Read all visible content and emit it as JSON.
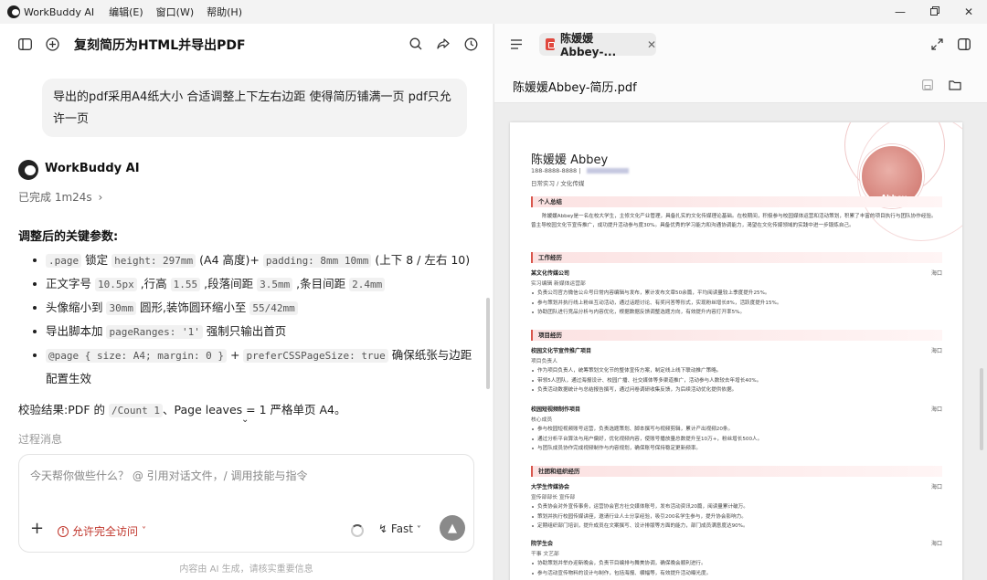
{
  "titlebar": {
    "app_name": "WorkBuddy AI",
    "menus": [
      "编辑(E)",
      "窗口(W)",
      "帮助(H)"
    ]
  },
  "conversation": {
    "title": "复刻简历为HTML并导出PDF",
    "user_message": "导出的pdf采用A4纸大小 合适调整上下左右边距 使得简历铺满一页 pdf只允许一页",
    "ai_name": "WorkBuddy AI",
    "done_status": "已完成 1m24s",
    "section_title": "调整后的关键参数:",
    "bullets": [
      {
        "parts": [
          ".page",
          " 锁定 ",
          "height: 297mm",
          " (A4 高度)+ ",
          "padding: 8mm 10mm",
          " (上下 8 / 左右 10)"
        ]
      },
      {
        "parts": [
          "正文字号 ",
          "10.5px",
          " ,行高 ",
          "1.55",
          " ,段落间距 ",
          "3.5mm",
          " ,条目间距 ",
          "2.4mm"
        ]
      },
      {
        "parts": [
          "头像缩小到 ",
          "30mm",
          " 圆形,装饰圆环缩小至 ",
          "55/42mm"
        ]
      },
      {
        "parts": [
          "导出脚本加 ",
          "pageRanges: '1'",
          " 强制只输出首页"
        ]
      },
      {
        "parts": [
          "@page { size: A4; margin: 0 }",
          " + ",
          "preferCSSPageSize: true",
          " 确保纸张与边距配置生效"
        ]
      }
    ],
    "verify": {
      "prefix": "校验结果:PDF 的 ",
      "code": "/Count 1",
      "suffix": "、Page leaves = 1 严格单页 A4。"
    },
    "process_label": "过程消息",
    "input_placeholder": "今天帮你做些什么？ @ 引用对话文件，/ 调用技能与指令",
    "access_label": "允许完全访问",
    "fast_label": "Fast",
    "footer_note": "内容由 AI 生成，请核实重要信息"
  },
  "preview": {
    "tab_label": "陈媛媛Abbey-...",
    "file_title": "陈媛媛Abbey-简历.pdf"
  },
  "resume": {
    "name": "陈媛媛 Abbey",
    "phone": "188-8888-8888",
    "intent": "日常实习 / 文化传媒",
    "photo_label": "Abbey",
    "sections": {
      "summary": "个人总结",
      "work": "工作经历",
      "project": "项目经历",
      "club": "社团和组织经历"
    },
    "summary_text": "陈媛媛Abbey是一名在校大学生，主修文化产业管理，具备扎实的文化传媒理论基础。在校期间，积极参与校园媒体运营和活动策划，积累了丰富的项目执行与团队协作经验。曾主导校园文化节宣传推广，成功提升活动参与度30%。具备优秀的学习能力和沟通协调能力，渴望在文化传媒领域的实践中进一步锻炼自己。",
    "work": [
      {
        "org": "某文化传媒公司",
        "loc": "海口",
        "role": "实习编辑 新媒体运营部",
        "items": [
          "负责公司官方微信公众号日常内容编辑与发布，累计发布文章50余篇，平均阅读量较上季度提升25%。",
          "参与策划并执行线上粉丝互动活动，通过话题讨论、有奖问答等形式，实现粉丝增长8%，活跃度提升15%。",
          "协助团队进行竞品分析与内容优化，根据数据反馈调整选题方向，有效提升内容打开率5%。"
        ]
      }
    ],
    "projects": [
      {
        "org": "校园文化节宣传推广项目",
        "loc": "海口",
        "role": "项目负责人",
        "items": [
          "作为项目负责人，统筹策划文化节的整体宣传方案，制定线上线下联动推广策略。",
          "带领5人团队，通过海报设计、校园广播、社交媒体等多渠道推广，活动参与人数较去年增长40%。",
          "负责活动数据统计与总结报告撰写，通过问卷调研收集反馈，为后续活动优化提供依据。"
        ]
      },
      {
        "org": "校园短视频制作项目",
        "loc": "海口",
        "role": "核心成员",
        "items": [
          "参与校园短视频账号运营，负责选题策划、脚本撰写与视频剪辑，累计产出视频20条。",
          "通过分析平台算法与用户偏好，优化视频内容，使账号播放量总数提升至10万+，粉丝增长500人。",
          "与团队成员协作完成视频制作与内容规划，确保账号保持稳定更新频率。"
        ]
      }
    ],
    "clubs": [
      {
        "org": "大学生传媒协会",
        "loc": "海口",
        "role": "宣传部部长 宣传部",
        "items": [
          "负责协会对外宣传事务，运营协会官方社交媒体账号，发布活动资讯20篇，阅读量累计破万。",
          "策划并执行校园传媒讲座，邀请行业人士分享经验，吸引200名学生参与，提升协会影响力。",
          "定期组织部门培训，提升成员在文案撰写、设计排版等方面的能力，部门成员满意度达90%。"
        ]
      },
      {
        "org": "院学生会",
        "loc": "海口",
        "role": "干事 文艺部",
        "items": [
          "协助策划并举办迎新晚会，负责节目编排与舞美协调，确保晚会顺利进行。",
          "参与活动宣传物料的设计与制作，包括海报、横幅等，有效提升活动曝光度。"
        ]
      }
    ]
  }
}
